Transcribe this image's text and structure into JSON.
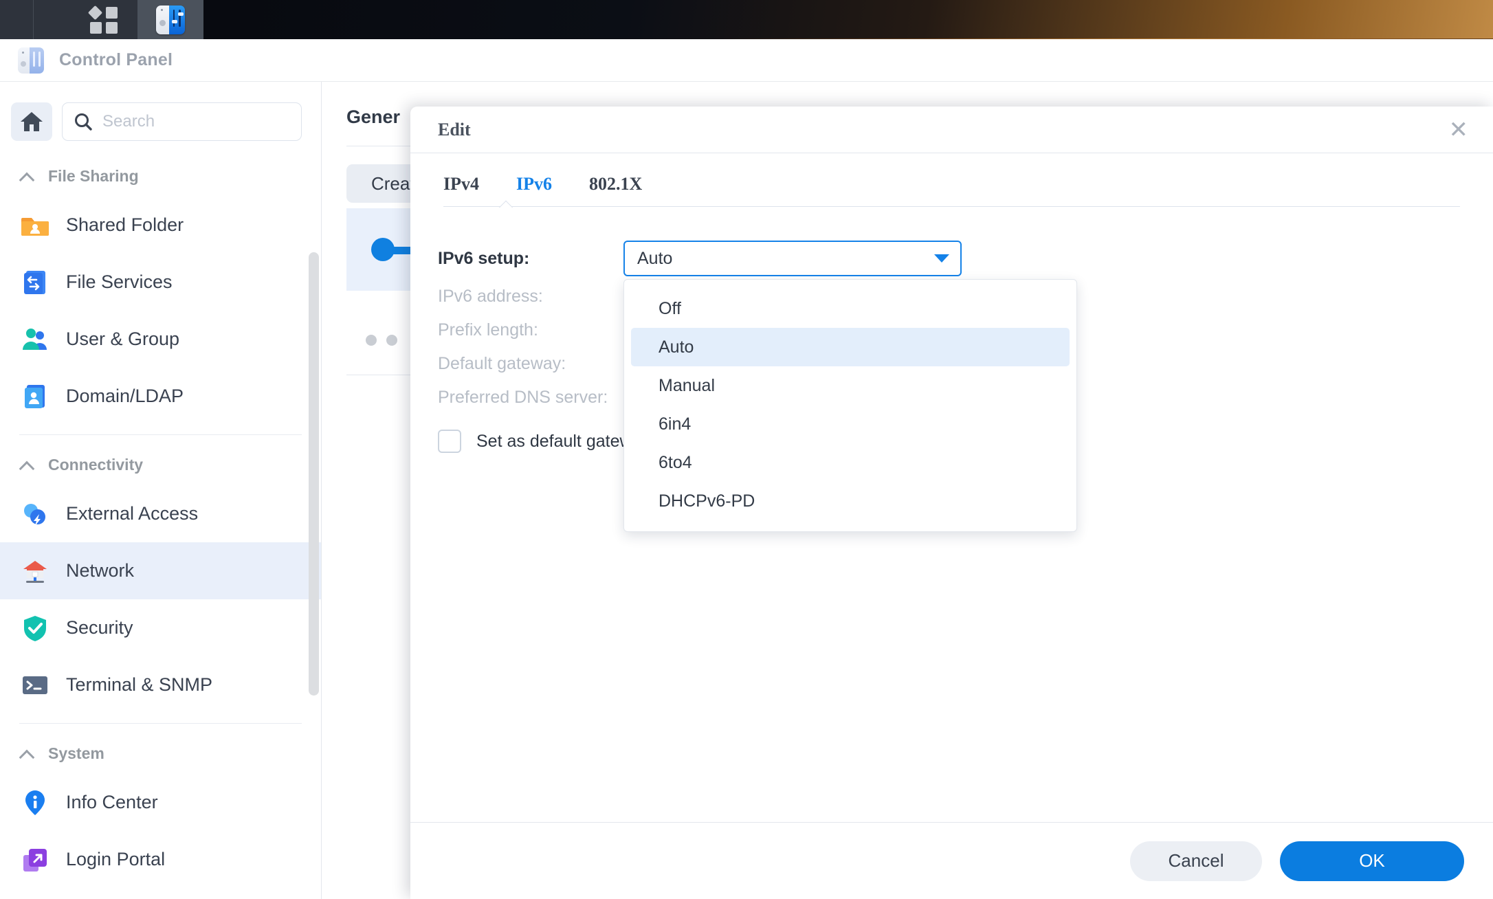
{
  "taskbar": {
    "items": [
      {
        "name": "apps-icon",
        "label": "Apps"
      },
      {
        "name": "control-panel-icon",
        "label": "Control Panel"
      }
    ]
  },
  "window": {
    "title": "Control Panel",
    "icon": "control-panel-icon"
  },
  "sidebar": {
    "home_icon": "home-icon",
    "search": {
      "placeholder": "Search",
      "value": ""
    },
    "groups": [
      {
        "label": "File Sharing",
        "items": [
          {
            "label": "Shared Folder",
            "icon": "shared-folder-icon"
          },
          {
            "label": "File Services",
            "icon": "file-services-icon"
          },
          {
            "label": "User & Group",
            "icon": "user-group-icon"
          },
          {
            "label": "Domain/LDAP",
            "icon": "domain-ldap-icon"
          }
        ]
      },
      {
        "label": "Connectivity",
        "items": [
          {
            "label": "External Access",
            "icon": "external-access-icon"
          },
          {
            "label": "Network",
            "icon": "network-icon",
            "active": true
          },
          {
            "label": "Security",
            "icon": "security-shield-icon"
          },
          {
            "label": "Terminal & SNMP",
            "icon": "terminal-icon"
          }
        ]
      },
      {
        "label": "System",
        "items": [
          {
            "label": "Info Center",
            "icon": "info-center-icon"
          },
          {
            "label": "Login Portal",
            "icon": "login-portal-icon"
          }
        ]
      }
    ]
  },
  "main": {
    "heading": "Gener",
    "create_button": "Creat",
    "info_icon": "info-icon"
  },
  "dialog": {
    "title": "Edit",
    "close_icon": "close-icon",
    "tabs": [
      {
        "label": "IPv4",
        "active": false
      },
      {
        "label": "IPv6",
        "active": true
      },
      {
        "label": "802.1X",
        "active": false
      }
    ],
    "fields": [
      {
        "label": "IPv6 setup:",
        "disabled": false
      },
      {
        "label": "IPv6 address:",
        "disabled": true
      },
      {
        "label": "Prefix length:",
        "disabled": true
      },
      {
        "label": "Default gateway:",
        "disabled": true
      },
      {
        "label": "Preferred DNS server:",
        "disabled": true
      }
    ],
    "ipv6_setup": {
      "value": "Auto",
      "expanded": true,
      "options": [
        "Off",
        "Auto",
        "Manual",
        "6in4",
        "6to4",
        "DHCPv6-PD"
      ],
      "selected_index": 1
    },
    "checkbox": {
      "label": "Set as default gateway",
      "checked": false
    },
    "buttons": {
      "cancel": "Cancel",
      "ok": "OK"
    }
  },
  "colors": {
    "accent": "#1582e8",
    "primary_button": "#0b7de0",
    "selected_row": "#e3eefb",
    "sidebar_active": "#e9effa"
  }
}
